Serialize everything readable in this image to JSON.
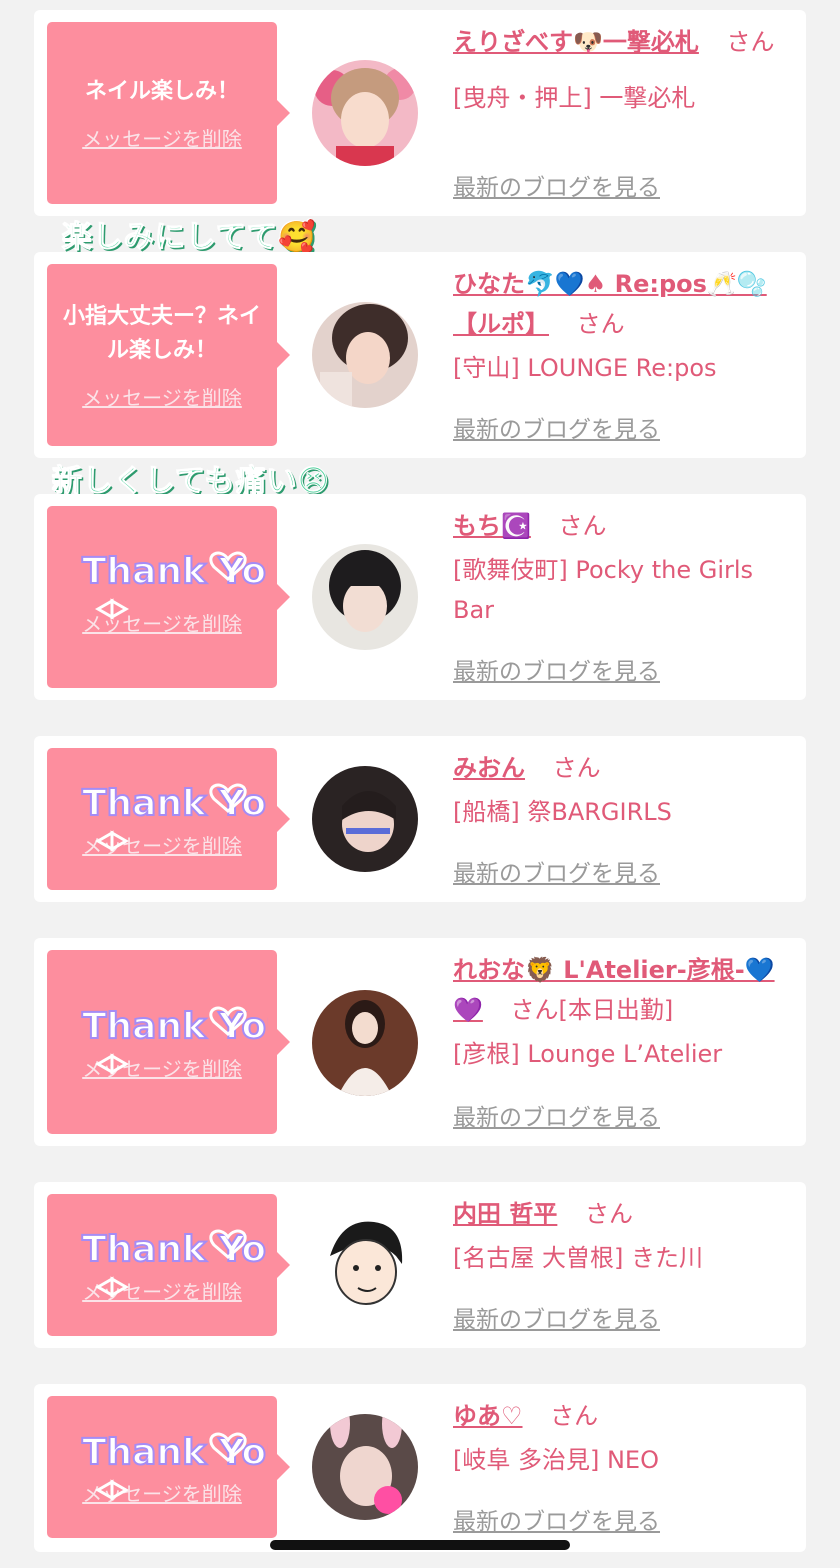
{
  "cards": [
    {
      "message": "ネイル楽しみ！",
      "delete_label": "メッセージを削除",
      "name": "えりざべす🐶一撃必札",
      "honorific": "さん",
      "shop": "[曳舟・押上] 一撃必札",
      "blog_link": "最新のブログを見る"
    },
    {
      "message": "小指大丈夫ー？ネイル楽しみ！",
      "delete_label": "メッセージを削除",
      "name": "ひなた🐬💙♠ Re:pos🥂🫧【ルポ】",
      "honorific": "さん",
      "shop": "[守山] LOUNGE Re:pos",
      "blog_link": "最新のブログを見る"
    },
    {
      "sticker": "Thank You",
      "delete_label": "メッセージを削除",
      "name": "もち☪️",
      "honorific": "さん",
      "shop": "[歌舞伎町] Pocky the Girls Bar",
      "blog_link": "最新のブログを見る"
    },
    {
      "sticker": "Thank You",
      "delete_label": "メッセージを削除",
      "name": "みおん",
      "honorific": "さん",
      "shop": "[船橋] 祭BARGIRLS",
      "blog_link": "最新のブログを見る"
    },
    {
      "sticker": "Thank You",
      "delete_label": "メッセージを削除",
      "name": "れおな🦁 L'Atelier-彦根-💙💜",
      "honorific": "さん",
      "status": "[本日出勤]",
      "shop": "[彦根] Lounge L’Atelier",
      "blog_link": "最新のブログを見る"
    },
    {
      "sticker": "Thank You",
      "delete_label": "メッセージを削除",
      "name": "内田 哲平",
      "honorific": "さん",
      "shop": "[名古屋 大曽根] きた川",
      "blog_link": "最新のブログを見る"
    },
    {
      "sticker": "Thank You",
      "delete_label": "メッセージを削除",
      "name": "ゆあ♡",
      "honorific": "さん",
      "shop": "[岐阜 多治見] NEO",
      "blog_link": "最新のブログを見る"
    }
  ],
  "overlays": {
    "sticker1": "楽しみにしてて🥰",
    "sticker2": "新しくしても痛い😣"
  },
  "colors": {
    "accent": "#e05a78",
    "bubble": "#fd8e9e",
    "background": "#f2f2f2",
    "link_gray": "#9a9a9a"
  }
}
